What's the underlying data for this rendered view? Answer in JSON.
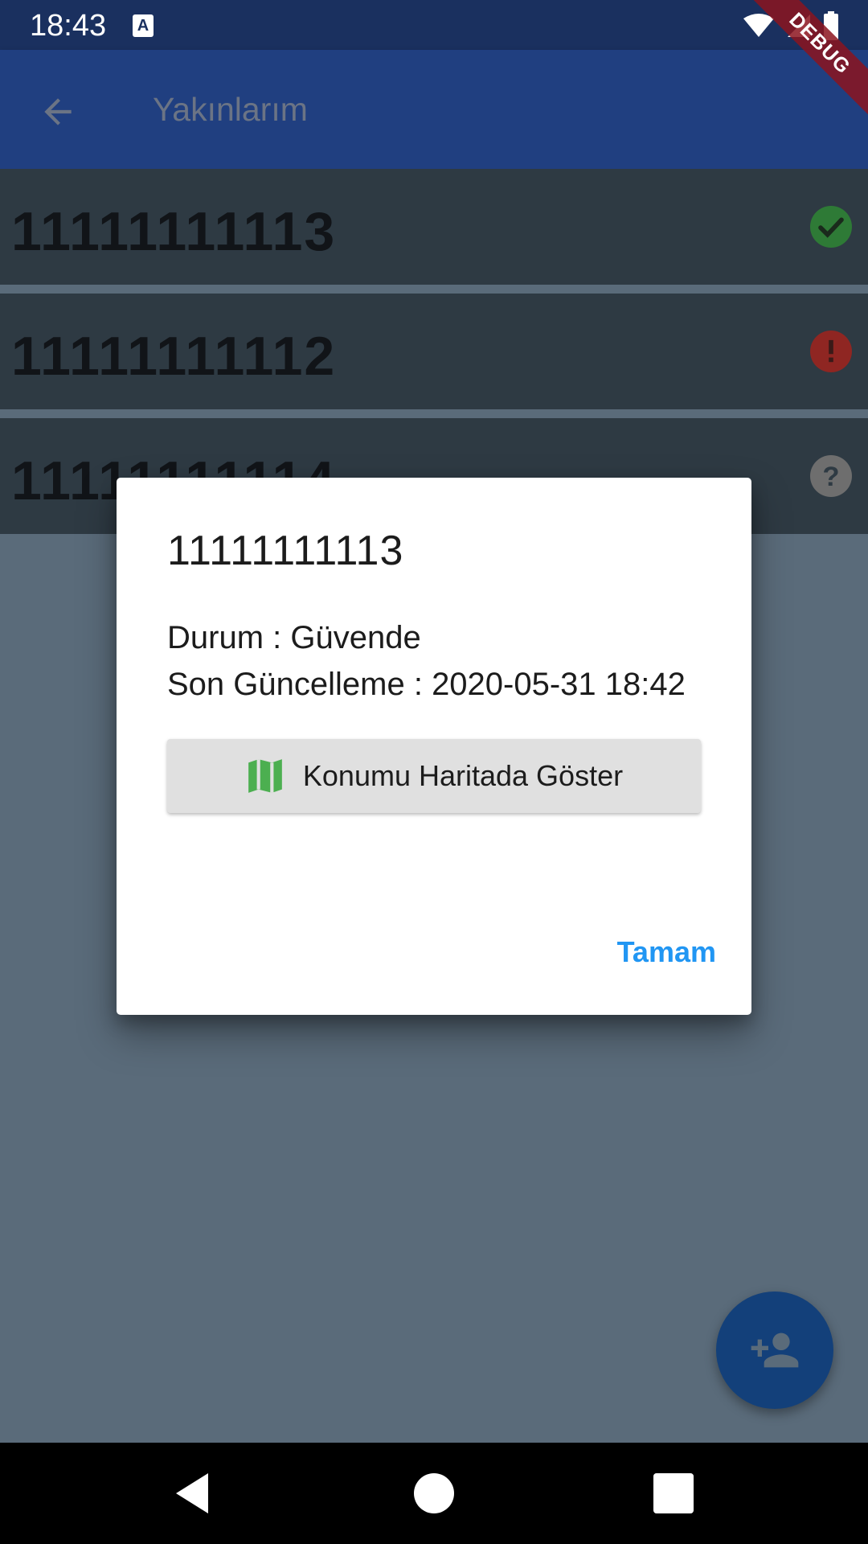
{
  "status_bar": {
    "time": "18:43",
    "notification_icon": "A"
  },
  "debug_banner": "DEBUG",
  "app_bar": {
    "title": "Yakınlarım",
    "back_icon": "arrow-back-icon"
  },
  "contacts": [
    {
      "number": "11111111113",
      "status_icon": "check-circle-icon",
      "status_color": "#2e8b3a"
    },
    {
      "number": "11111111112",
      "status_icon": "error-icon",
      "status_color": "#a8231f"
    },
    {
      "number": "11111111114",
      "status_icon": "help-icon",
      "status_color": "#6e6e6e"
    }
  ],
  "dialog": {
    "title": "11111111113",
    "status_line": "Durum : Güvende",
    "update_line": "Son Güncelleme : 2020-05-31 18:42",
    "map_button_label": "Konumu Haritada Göster",
    "ok_label": "Tamam"
  },
  "colors": {
    "app_bar": "#203f80",
    "status_bar": "#1a305f",
    "accent": "#2196f3",
    "map_icon": "#4caf50"
  }
}
